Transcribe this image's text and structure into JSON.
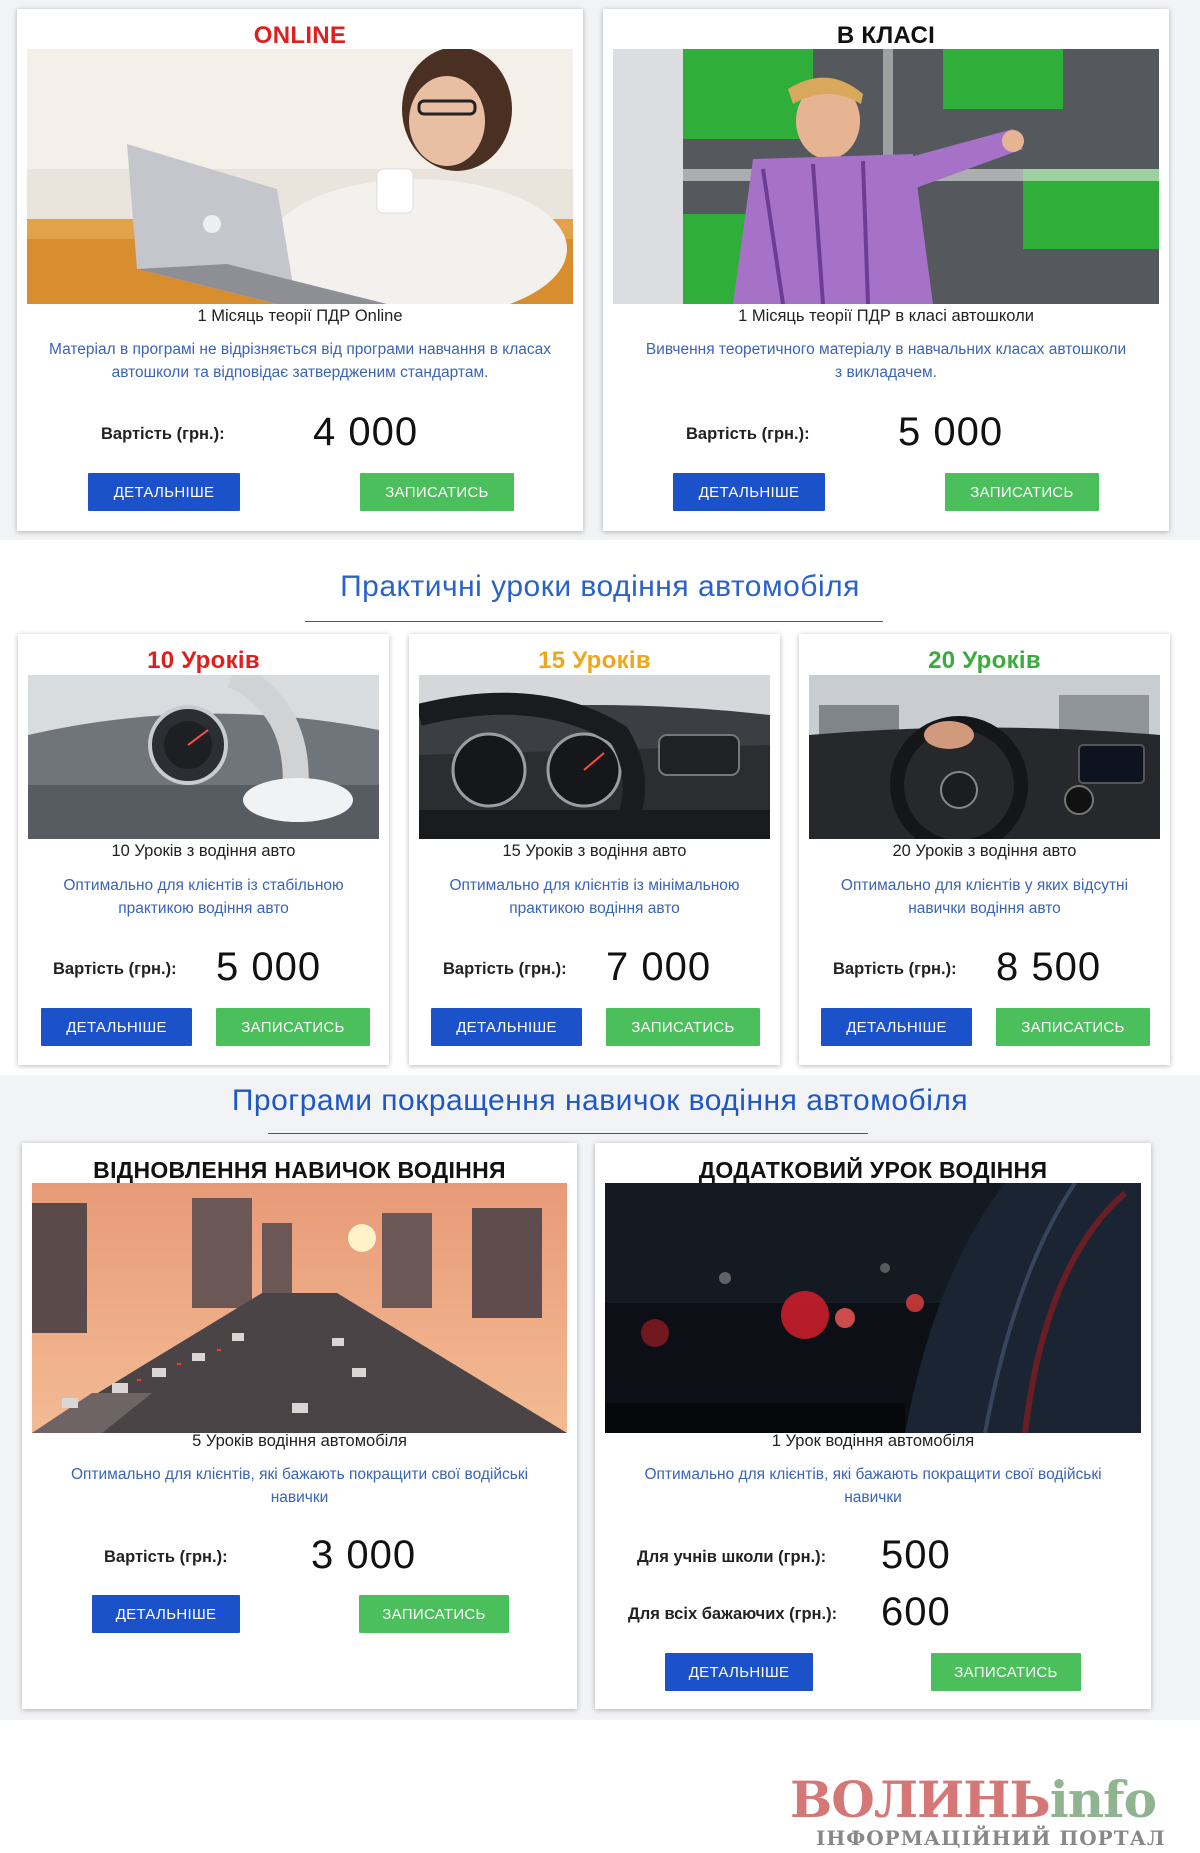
{
  "theory": {
    "cards": [
      {
        "title": "ONLINE",
        "subtitle": "1 Місяць теорії ПДР Online",
        "description": "Матеріал в програмі не відрізняється від програми навчання в класах автошколи та відповідає затвердженим стандартам.",
        "price_label": "Вартість (грн.):",
        "price": "4 000",
        "details_label": "ДЕТАЛЬНІШЕ",
        "signup_label": "ЗАПИСАТИСЬ",
        "title_color": "#e01e1e"
      },
      {
        "title": "В КЛАСІ",
        "subtitle": "1 Місяць теорії ПДР в класі автошколи",
        "description": "Вивчення теоретичного матеріалу в навчальних класах автошколи з викладачем.",
        "price_label": "Вартість (грн.):",
        "price": "5 000",
        "details_label": "ДЕТАЛЬНІШЕ",
        "signup_label": "ЗАПИСАТИСЬ",
        "title_color": "#111111"
      }
    ]
  },
  "practice": {
    "heading": "Практичні уроки водіння автомобіля",
    "cards": [
      {
        "title": "10 Уроків",
        "subtitle": "10 Уроків з водіння авто",
        "description": "Оптимально для клієнтів із стабільною практикою водіння авто",
        "price_label": "Вартість (грн.):",
        "price": "5 000",
        "details_label": "ДЕТАЛЬНІШЕ",
        "signup_label": "ЗАПИСАТИСЬ",
        "title_color": "#e01e1e"
      },
      {
        "title": "15 Уроків",
        "subtitle": "15 Уроків з водіння авто",
        "description": "Оптимально для клієнтів із мінімальною практикою водіння авто",
        "price_label": "Вартість (грн.):",
        "price": "7 000",
        "details_label": "ДЕТАЛЬНІШЕ",
        "signup_label": "ЗАПИСАТИСЬ",
        "title_color": "#f0a61c"
      },
      {
        "title": "20 Уроків",
        "subtitle": "20 Уроків з водіння авто",
        "description": "Оптимально для клієнтів у яких відсутні навички водіння авто",
        "price_label": "Вартість (грн.):",
        "price": "8 500",
        "details_label": "ДЕТАЛЬНІШЕ",
        "signup_label": "ЗАПИСАТИСЬ",
        "title_color": "#3aab3f"
      }
    ]
  },
  "improvement": {
    "heading": "Програми покращення навичок водіння автомобіля",
    "cards": [
      {
        "title": "ВІДНОВЛЕННЯ НАВИЧОК ВОДІННЯ",
        "subtitle": "5 Уроків водіння автомобіля",
        "description": "Оптимально для клієнтів, які бажають покращити свої водійські навички",
        "price_label": "Вартість (грн.):",
        "price": "3 000",
        "details_label": "ДЕТАЛЬНІШЕ",
        "signup_label": "ЗАПИСАТИСЬ",
        "title_color": "#111111"
      },
      {
        "title": "ДОДАТКОВИЙ УРОК ВОДІННЯ",
        "subtitle": "1 Урок водіння автомобіля",
        "description": "Оптимально для клієнтів, які бажають покращити свої водійські навички",
        "students_label": "Для учнів школи (грн.):",
        "students_price": "500",
        "all_label": "Для всіх бажаючих (грн.):",
        "all_price": "600",
        "details_label": "ДЕТАЛЬНІШЕ",
        "signup_label": "ЗАПИСАТИСЬ",
        "title_color": "#111111"
      }
    ]
  },
  "watermark": {
    "brand_main": "ВОЛИНЬ",
    "brand_suffix": "info",
    "tagline": "ІНФОРМАЦІЙНИЙ ПОРТАЛ"
  },
  "colors": {
    "accent_blue": "#1c52c9",
    "accent_green": "#4bbf5c",
    "heading_blue": "#2a63c6",
    "description_blue": "#3a64b5"
  }
}
